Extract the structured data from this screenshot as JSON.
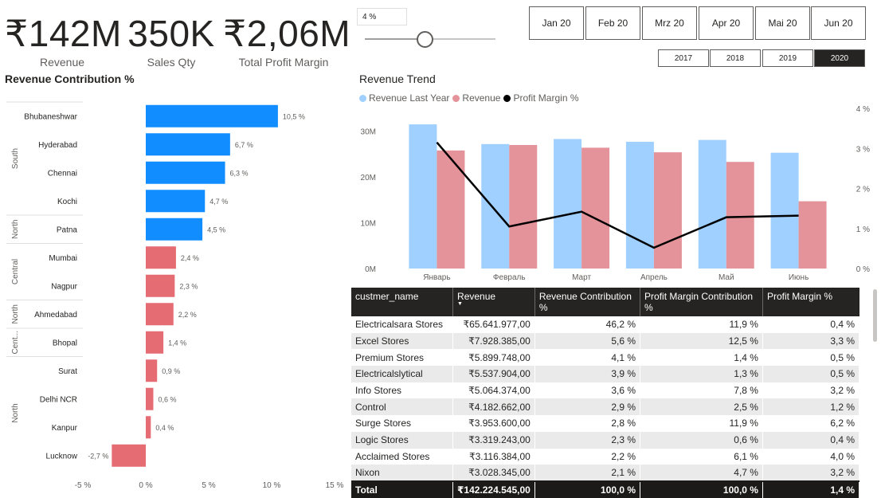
{
  "kpis": [
    {
      "value": "₹142M",
      "label": "Revenue"
    },
    {
      "value": "350K",
      "label": "Sales Qty"
    },
    {
      "value": "₹2,06M",
      "label": "Total Profit Margin"
    }
  ],
  "slicer": {
    "value": "4 %",
    "slider_level": 0.46
  },
  "months": [
    "Jan 20",
    "Feb 20",
    "Mrz 20",
    "Apr 20",
    "Mai 20",
    "Jun 20"
  ],
  "years": [
    "2017",
    "2018",
    "2019",
    "2020"
  ],
  "selected_year": "2020",
  "colors": {
    "positive_bar": "#118dff",
    "negative_bar": "#e66c74",
    "revenue_last_year": "#9fd0ff",
    "revenue": "#e5939a",
    "profit_margin_line": "#000000"
  },
  "chart_data": [
    {
      "type": "bar",
      "orientation": "horizontal",
      "title": "Revenue Contribution %",
      "categories": [
        "Bhubaneshwar",
        "Hyderabad",
        "Chennai",
        "Kochi",
        "Patna",
        "Mumbai",
        "Nagpur",
        "Ahmedabad",
        "Bhopal",
        "Surat",
        "Delhi NCR",
        "Kanpur",
        "Lucknow"
      ],
      "values": [
        10.5,
        6.7,
        6.3,
        4.7,
        4.5,
        2.4,
        2.3,
        2.2,
        1.4,
        0.9,
        0.6,
        0.4,
        -2.7
      ],
      "value_labels": [
        "10,5 %",
        "6,7 %",
        "6,3 %",
        "4,7 %",
        "4,5 %",
        "2,4 %",
        "2,3 %",
        "2,2 %",
        "1,4 %",
        "0,9 %",
        "0,6 %",
        "0,4 %",
        "-2,7 %"
      ],
      "groups": [
        {
          "name": "South",
          "count": 4
        },
        {
          "name": "North",
          "count": 1
        },
        {
          "name": "Central",
          "count": 2
        },
        {
          "name": "North",
          "count": 1
        },
        {
          "name": "Cent...",
          "count": 1
        },
        {
          "name": "North",
          "count": 4
        }
      ],
      "highlight_count": 5,
      "xlim": [
        -5,
        15
      ],
      "xticks": [
        -5,
        0,
        5,
        10,
        15
      ],
      "xtick_labels": [
        "-5 %",
        "0 %",
        "5 %",
        "10 %",
        "15 %"
      ]
    },
    {
      "type": "bar",
      "subtype": "clustered-column-with-line",
      "title": "Revenue Trend",
      "categories": [
        "Январь",
        "Февраль",
        "Март",
        "Апрель",
        "Май",
        "Июнь"
      ],
      "series": [
        {
          "name": "Revenue Last Year",
          "kind": "bar",
          "values": [
            31.5,
            27.2,
            28.3,
            27.7,
            28.1,
            25.3
          ]
        },
        {
          "name": "Revenue",
          "kind": "bar",
          "values": [
            25.8,
            27.0,
            26.4,
            25.4,
            23.3,
            14.7
          ]
        },
        {
          "name": "Profit Margin %",
          "kind": "line",
          "axis": "right",
          "values": [
            3.15,
            1.05,
            1.42,
            0.52,
            1.28,
            1.32
          ]
        }
      ],
      "ylim": [
        0,
        35
      ],
      "yticks": [
        0,
        10,
        20,
        30
      ],
      "ytick_labels": [
        "0M",
        "10M",
        "20M",
        "30M"
      ],
      "y2lim": [
        0,
        4
      ],
      "y2ticks": [
        0,
        1,
        2,
        3,
        4
      ],
      "y2tick_labels": [
        "0 %",
        "1 %",
        "2 %",
        "3 %",
        "4 %"
      ],
      "legend": "top-left"
    }
  ],
  "table": {
    "columns": [
      "custmer_name",
      "Revenue",
      "Revenue Contribution %",
      "Profit Margin Contribution %",
      "Profit Margin %"
    ],
    "rows": [
      [
        "Electricalsara Stores",
        "₹65.641.977,00",
        "46,2 %",
        "11,9 %",
        "0,4 %"
      ],
      [
        "Excel Stores",
        "₹7.928.385,00",
        "5,6 %",
        "12,5 %",
        "3,3 %"
      ],
      [
        "Premium Stores",
        "₹5.899.748,00",
        "4,1 %",
        "1,4 %",
        "0,5 %"
      ],
      [
        "Electricalslytical",
        "₹5.537.904,00",
        "3,9 %",
        "1,3 %",
        "0,5 %"
      ],
      [
        "Info Stores",
        "₹5.064.374,00",
        "3,6 %",
        "7,8 %",
        "3,2 %"
      ],
      [
        "Control",
        "₹4.182.662,00",
        "2,9 %",
        "2,5 %",
        "1,2 %"
      ],
      [
        "Surge Stores",
        "₹3.953.600,00",
        "2,8 %",
        "11,9 %",
        "6,2 %"
      ],
      [
        "Logic Stores",
        "₹3.319.243,00",
        "2,3 %",
        "0,6 %",
        "0,4 %"
      ],
      [
        "Acclaimed Stores",
        "₹3.116.384,00",
        "2,2 %",
        "6,1 %",
        "4,0 %"
      ],
      [
        "Nixon",
        "₹3.028.345,00",
        "2,1 %",
        "4,7 %",
        "3,2 %"
      ]
    ],
    "total": [
      "Total",
      "₹142.224.545,00",
      "100,0 %",
      "100,0 %",
      "1,4 %"
    ]
  }
}
